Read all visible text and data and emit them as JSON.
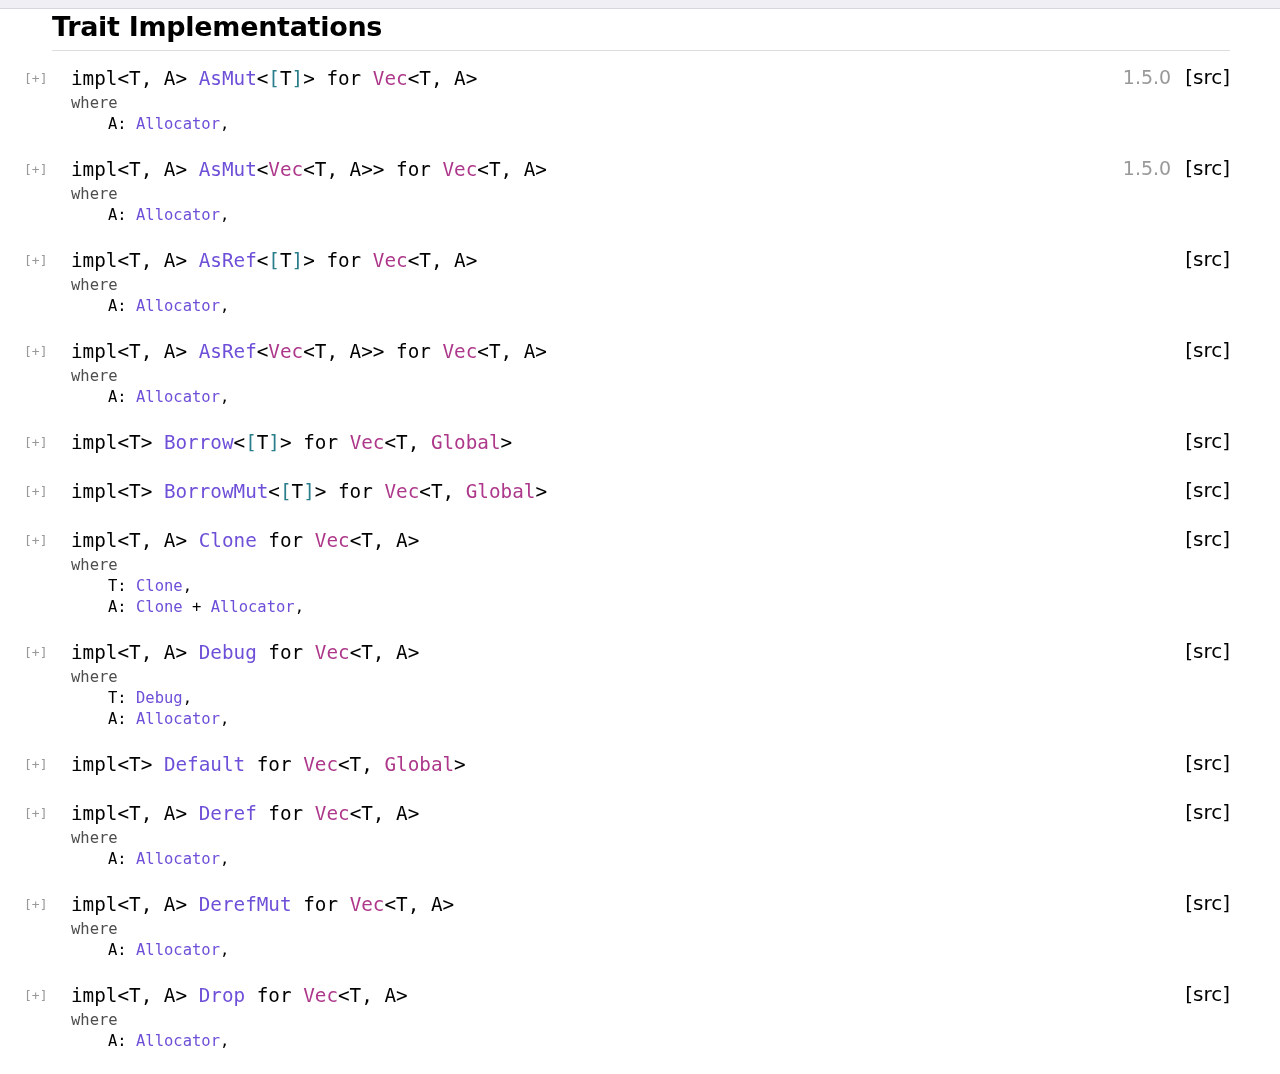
{
  "title": "Trait Implementations",
  "impls": [
    {
      "toggle": "[+]",
      "signature": [
        {
          "kind": "plain",
          "text": "impl<T, A> "
        },
        {
          "kind": "trait",
          "text": "AsMut"
        },
        {
          "kind": "plain",
          "text": "<"
        },
        {
          "kind": "primitive",
          "text": "["
        },
        {
          "kind": "plain",
          "text": "T"
        },
        {
          "kind": "primitive",
          "text": "]"
        },
        {
          "kind": "plain",
          "text": "> for "
        },
        {
          "kind": "struct",
          "text": "Vec"
        },
        {
          "kind": "plain",
          "text": "<T, A>"
        }
      ],
      "where": "where",
      "bounds": [
        [
          {
            "kind": "plain",
            "text": "A: "
          },
          {
            "kind": "trait",
            "text": "Allocator"
          },
          {
            "kind": "plain",
            "text": ","
          }
        ]
      ],
      "version": "1.5.0",
      "src": "[src]"
    },
    {
      "toggle": "[+]",
      "signature": [
        {
          "kind": "plain",
          "text": "impl<T, A> "
        },
        {
          "kind": "trait",
          "text": "AsMut"
        },
        {
          "kind": "plain",
          "text": "<"
        },
        {
          "kind": "struct",
          "text": "Vec"
        },
        {
          "kind": "plain",
          "text": "<T, A>> for "
        },
        {
          "kind": "struct",
          "text": "Vec"
        },
        {
          "kind": "plain",
          "text": "<T, A>"
        }
      ],
      "where": "where",
      "bounds": [
        [
          {
            "kind": "plain",
            "text": "A: "
          },
          {
            "kind": "trait",
            "text": "Allocator"
          },
          {
            "kind": "plain",
            "text": ","
          }
        ]
      ],
      "version": "1.5.0",
      "src": "[src]"
    },
    {
      "toggle": "[+]",
      "signature": [
        {
          "kind": "plain",
          "text": "impl<T, A> "
        },
        {
          "kind": "trait",
          "text": "AsRef"
        },
        {
          "kind": "plain",
          "text": "<"
        },
        {
          "kind": "primitive",
          "text": "["
        },
        {
          "kind": "plain",
          "text": "T"
        },
        {
          "kind": "primitive",
          "text": "]"
        },
        {
          "kind": "plain",
          "text": "> for "
        },
        {
          "kind": "struct",
          "text": "Vec"
        },
        {
          "kind": "plain",
          "text": "<T, A>"
        }
      ],
      "where": "where",
      "bounds": [
        [
          {
            "kind": "plain",
            "text": "A: "
          },
          {
            "kind": "trait",
            "text": "Allocator"
          },
          {
            "kind": "plain",
            "text": ","
          }
        ]
      ],
      "src": "[src]"
    },
    {
      "toggle": "[+]",
      "signature": [
        {
          "kind": "plain",
          "text": "impl<T, A> "
        },
        {
          "kind": "trait",
          "text": "AsRef"
        },
        {
          "kind": "plain",
          "text": "<"
        },
        {
          "kind": "struct",
          "text": "Vec"
        },
        {
          "kind": "plain",
          "text": "<T, A>> for "
        },
        {
          "kind": "struct",
          "text": "Vec"
        },
        {
          "kind": "plain",
          "text": "<T, A>"
        }
      ],
      "where": "where",
      "bounds": [
        [
          {
            "kind": "plain",
            "text": "A: "
          },
          {
            "kind": "trait",
            "text": "Allocator"
          },
          {
            "kind": "plain",
            "text": ","
          }
        ]
      ],
      "src": "[src]"
    },
    {
      "toggle": "[+]",
      "signature": [
        {
          "kind": "plain",
          "text": "impl<T> "
        },
        {
          "kind": "trait",
          "text": "Borrow"
        },
        {
          "kind": "plain",
          "text": "<"
        },
        {
          "kind": "primitive",
          "text": "["
        },
        {
          "kind": "plain",
          "text": "T"
        },
        {
          "kind": "primitive",
          "text": "]"
        },
        {
          "kind": "plain",
          "text": "> for "
        },
        {
          "kind": "struct",
          "text": "Vec"
        },
        {
          "kind": "plain",
          "text": "<T, "
        },
        {
          "kind": "struct",
          "text": "Global"
        },
        {
          "kind": "plain",
          "text": ">"
        }
      ],
      "src": "[src]"
    },
    {
      "toggle": "[+]",
      "signature": [
        {
          "kind": "plain",
          "text": "impl<T> "
        },
        {
          "kind": "trait",
          "text": "BorrowMut"
        },
        {
          "kind": "plain",
          "text": "<"
        },
        {
          "kind": "primitive",
          "text": "["
        },
        {
          "kind": "plain",
          "text": "T"
        },
        {
          "kind": "primitive",
          "text": "]"
        },
        {
          "kind": "plain",
          "text": "> for "
        },
        {
          "kind": "struct",
          "text": "Vec"
        },
        {
          "kind": "plain",
          "text": "<T, "
        },
        {
          "kind": "struct",
          "text": "Global"
        },
        {
          "kind": "plain",
          "text": ">"
        }
      ],
      "src": "[src]"
    },
    {
      "toggle": "[+]",
      "signature": [
        {
          "kind": "plain",
          "text": "impl<T, A> "
        },
        {
          "kind": "trait",
          "text": "Clone"
        },
        {
          "kind": "plain",
          "text": " for "
        },
        {
          "kind": "struct",
          "text": "Vec"
        },
        {
          "kind": "plain",
          "text": "<T, A>"
        }
      ],
      "where": "where",
      "bounds": [
        [
          {
            "kind": "plain",
            "text": "T: "
          },
          {
            "kind": "trait",
            "text": "Clone"
          },
          {
            "kind": "plain",
            "text": ","
          }
        ],
        [
          {
            "kind": "plain",
            "text": "A: "
          },
          {
            "kind": "trait",
            "text": "Clone"
          },
          {
            "kind": "plain",
            "text": " + "
          },
          {
            "kind": "trait",
            "text": "Allocator"
          },
          {
            "kind": "plain",
            "text": ","
          }
        ]
      ],
      "src": "[src]"
    },
    {
      "toggle": "[+]",
      "signature": [
        {
          "kind": "plain",
          "text": "impl<T, A> "
        },
        {
          "kind": "trait",
          "text": "Debug"
        },
        {
          "kind": "plain",
          "text": " for "
        },
        {
          "kind": "struct",
          "text": "Vec"
        },
        {
          "kind": "plain",
          "text": "<T, A>"
        }
      ],
      "where": "where",
      "bounds": [
        [
          {
            "kind": "plain",
            "text": "T: "
          },
          {
            "kind": "trait",
            "text": "Debug"
          },
          {
            "kind": "plain",
            "text": ","
          }
        ],
        [
          {
            "kind": "plain",
            "text": "A: "
          },
          {
            "kind": "trait",
            "text": "Allocator"
          },
          {
            "kind": "plain",
            "text": ","
          }
        ]
      ],
      "src": "[src]"
    },
    {
      "toggle": "[+]",
      "signature": [
        {
          "kind": "plain",
          "text": "impl<T> "
        },
        {
          "kind": "trait",
          "text": "Default"
        },
        {
          "kind": "plain",
          "text": " for "
        },
        {
          "kind": "struct",
          "text": "Vec"
        },
        {
          "kind": "plain",
          "text": "<T, "
        },
        {
          "kind": "struct",
          "text": "Global"
        },
        {
          "kind": "plain",
          "text": ">"
        }
      ],
      "src": "[src]"
    },
    {
      "toggle": "[+]",
      "signature": [
        {
          "kind": "plain",
          "text": "impl<T, A> "
        },
        {
          "kind": "trait",
          "text": "Deref"
        },
        {
          "kind": "plain",
          "text": " for "
        },
        {
          "kind": "struct",
          "text": "Vec"
        },
        {
          "kind": "plain",
          "text": "<T, A>"
        }
      ],
      "where": "where",
      "bounds": [
        [
          {
            "kind": "plain",
            "text": "A: "
          },
          {
            "kind": "trait",
            "text": "Allocator"
          },
          {
            "kind": "plain",
            "text": ","
          }
        ]
      ],
      "src": "[src]"
    },
    {
      "toggle": "[+]",
      "signature": [
        {
          "kind": "plain",
          "text": "impl<T, A> "
        },
        {
          "kind": "trait",
          "text": "DerefMut"
        },
        {
          "kind": "plain",
          "text": " for "
        },
        {
          "kind": "struct",
          "text": "Vec"
        },
        {
          "kind": "plain",
          "text": "<T, A>"
        }
      ],
      "where": "where",
      "bounds": [
        [
          {
            "kind": "plain",
            "text": "A: "
          },
          {
            "kind": "trait",
            "text": "Allocator"
          },
          {
            "kind": "plain",
            "text": ","
          }
        ]
      ],
      "src": "[src]"
    },
    {
      "toggle": "[+]",
      "signature": [
        {
          "kind": "plain",
          "text": "impl<T, A> "
        },
        {
          "kind": "trait",
          "text": "Drop"
        },
        {
          "kind": "plain",
          "text": " for "
        },
        {
          "kind": "struct",
          "text": "Vec"
        },
        {
          "kind": "plain",
          "text": "<T, A>"
        }
      ],
      "where": "where",
      "bounds": [
        [
          {
            "kind": "plain",
            "text": "A: "
          },
          {
            "kind": "trait",
            "text": "Allocator"
          },
          {
            "kind": "plain",
            "text": ","
          }
        ]
      ],
      "src": "[src]"
    }
  ]
}
